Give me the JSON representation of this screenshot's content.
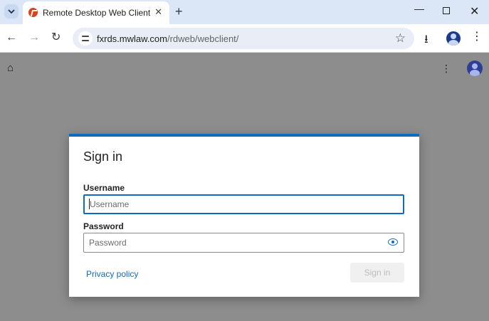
{
  "browser": {
    "tab": {
      "title": "Remote Desktop Web Client",
      "close": "✕"
    },
    "new_tab": "+",
    "window_controls": {
      "minimize": "—",
      "close": "✕"
    },
    "nav": {
      "back": "←",
      "forward": "→",
      "reload": "↻"
    },
    "url": {
      "host": "fxrds.mwlaw.com",
      "path": "/rdweb/webclient/"
    },
    "icons": {
      "star": "☆",
      "download": "⭳",
      "menu": "⋮",
      "home": "⌂"
    }
  },
  "page": {
    "menu": "⋮"
  },
  "signin": {
    "title": "Sign in",
    "username_label": "Username",
    "username_placeholder": "Username",
    "password_label": "Password",
    "password_placeholder": "Password",
    "privacy_link": "Privacy policy",
    "signin_button": "Sign in"
  },
  "colors": {
    "accent": "#0f6cbd",
    "overlay": "#8d8d8d",
    "titlebar": "#dbe7f7"
  }
}
